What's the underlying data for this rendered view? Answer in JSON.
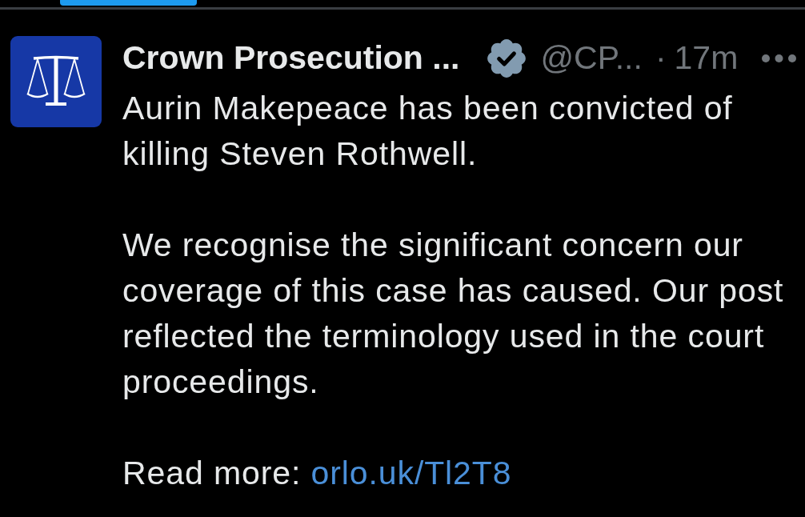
{
  "post": {
    "author": {
      "name": "Crown Prosecution ...",
      "verified": true,
      "handle": "@CP...",
      "separator": "·",
      "time": "17m"
    },
    "paragraphs": [
      {
        "lines": [
          "Aurin Makepeace has been convicted of",
          "killing Steven Rothwell."
        ]
      },
      {
        "lines": [
          "We recognise the significant concern our",
          "coverage of this case has caused. Our post",
          "reflected the terminology used in the court",
          "proceedings."
        ]
      }
    ],
    "read_more": {
      "label": "Read more:",
      "link": "orlo.uk/Tl2T8"
    }
  }
}
